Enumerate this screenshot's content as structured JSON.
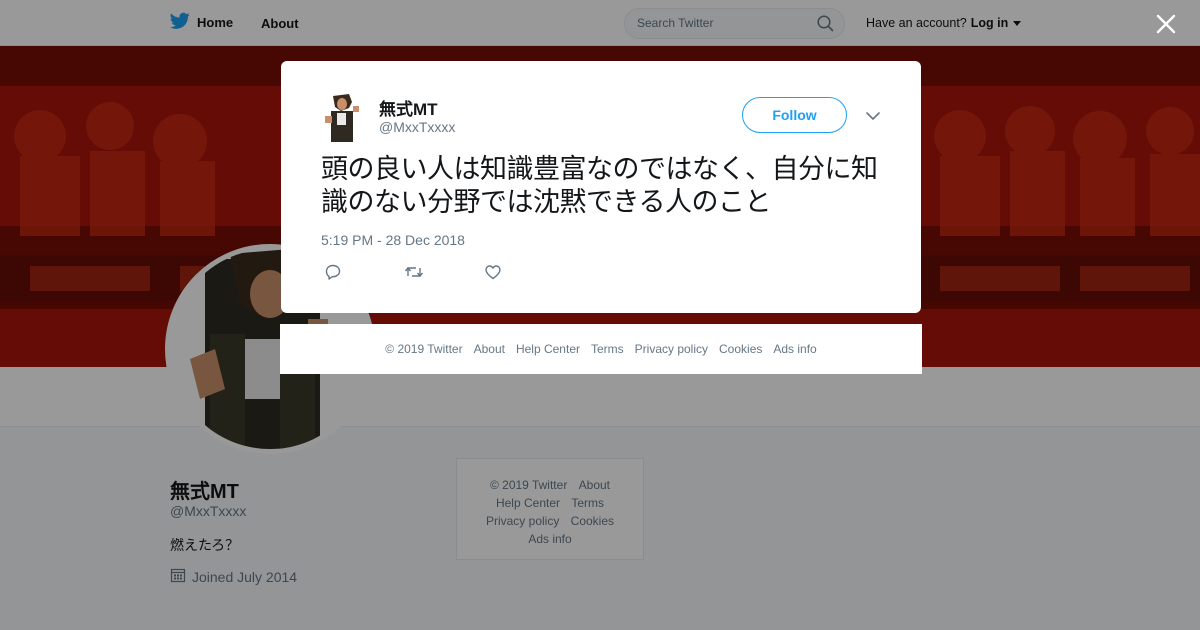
{
  "topbar": {
    "home_label": "Home",
    "about_label": "About",
    "search_placeholder": "Search Twitter",
    "account_prompt": "Have an account?",
    "login_label": "Log in"
  },
  "profile": {
    "name": "無式MT",
    "handle": "@MxxTxxxx",
    "bio": "燃えたろ？",
    "joined": "Joined July 2014"
  },
  "side_footer": {
    "links": [
      "© 2019 Twitter",
      "About",
      "Help Center",
      "Terms",
      "Privacy policy",
      "Cookies",
      "Ads info"
    ]
  },
  "tweet": {
    "author_name": "無式MT",
    "author_handle": "@MxxTxxxx",
    "follow_label": "Follow",
    "text": "頭の良い人は知識豊富なのではなく、自分に知識のない分野では沈黙できる人のこと",
    "timestamp": "5:19 PM - 28 Dec 2018"
  },
  "modal_footer": {
    "links": [
      "© 2019 Twitter",
      "About",
      "Help Center",
      "Terms",
      "Privacy policy",
      "Cookies",
      "Ads info"
    ]
  },
  "colors": {
    "twitter_blue": "#1da1f2",
    "banner_red": "#b51a0a",
    "text_primary": "#14171a",
    "text_secondary": "#657786"
  },
  "icons": [
    "twitter-bird-icon",
    "search-icon",
    "calendar-icon",
    "close-icon",
    "chevron-down-icon",
    "reply-icon",
    "retweet-icon",
    "like-icon"
  ]
}
